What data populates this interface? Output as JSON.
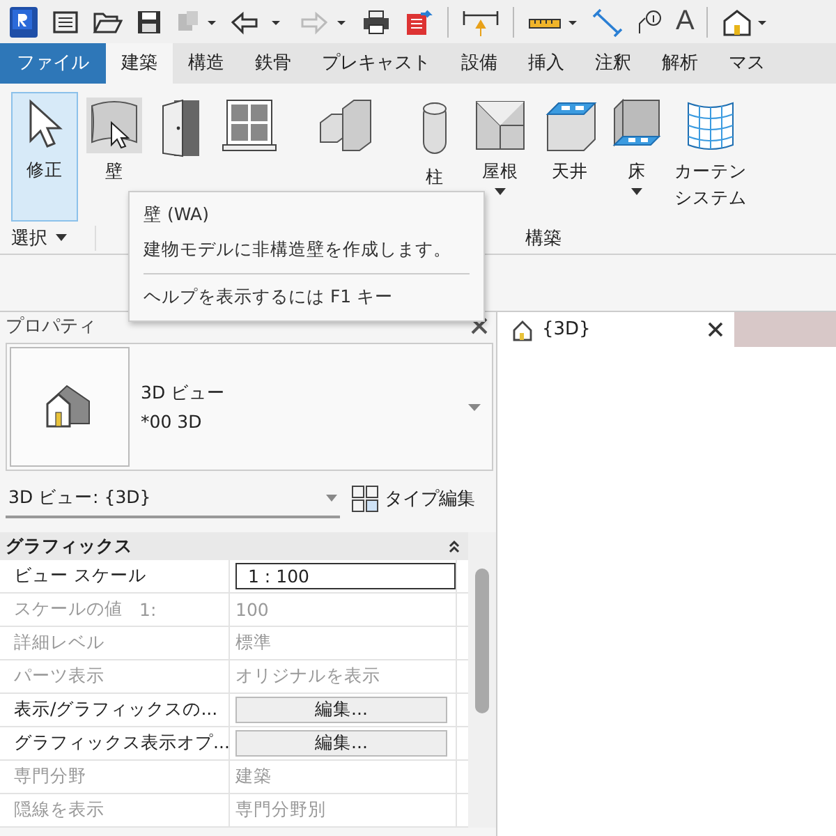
{
  "quick_access": {
    "text_tool": "A"
  },
  "tabs": [
    {
      "label": "ファイル",
      "kind": "file",
      "selected": false
    },
    {
      "label": "建築",
      "kind": "tab",
      "selected": true
    },
    {
      "label": "構造",
      "kind": "tab",
      "selected": false
    },
    {
      "label": "鉄骨",
      "kind": "tab",
      "selected": false
    },
    {
      "label": "プレキャスト",
      "kind": "tab",
      "selected": false
    },
    {
      "label": "設備",
      "kind": "tab",
      "selected": false
    },
    {
      "label": "挿入",
      "kind": "tab",
      "selected": false
    },
    {
      "label": "注釈",
      "kind": "tab",
      "selected": false
    },
    {
      "label": "解析",
      "kind": "tab",
      "selected": false
    },
    {
      "label": "マス",
      "kind": "tab",
      "selected": false
    }
  ],
  "ribbon_tools": [
    {
      "kind": "cursor",
      "label": "修正",
      "selected": true,
      "hovered": false
    },
    {
      "kind": "wall",
      "label": "壁",
      "selected": false,
      "hovered": true
    },
    {
      "kind": "door",
      "selected": false,
      "hovered": false
    },
    {
      "kind": "window",
      "selected": false,
      "hovered": false
    },
    {
      "kind": "component",
      "selected": false,
      "hovered": false
    },
    {
      "kind": "column",
      "label": "柱",
      "selected": false,
      "hovered": false
    },
    {
      "kind": "roof",
      "label": "屋根",
      "dropdown": true,
      "selected": false,
      "hovered": false
    },
    {
      "kind": "ceiling",
      "label": "天井",
      "selected": false,
      "hovered": false
    },
    {
      "kind": "floor",
      "label": "床",
      "dropdown": true,
      "selected": false,
      "hovered": false
    },
    {
      "kind": "curtain",
      "label": "カーテンシステム",
      "selected": false,
      "hovered": false
    }
  ],
  "ribbon_panels": [
    {
      "label": "選択",
      "dropdown": true
    },
    {
      "label": "構築",
      "dropdown": false
    }
  ],
  "tooltip": {
    "title": "壁 (WA)",
    "description": "建物モデルに非構造壁を作成します。",
    "help": "ヘルプを表示するには F1 キー"
  },
  "properties": {
    "title": "プロパティ",
    "type_name": "3D ビュー",
    "type_sub": "*00 3D",
    "selector": "3D ビュー: {3D}",
    "edit_type": "タイプ編集",
    "section": "グラフィックス",
    "rows": [
      {
        "label": "ビュー スケール",
        "value": "1 : 100",
        "kind": "field",
        "disabled": false
      },
      {
        "label": "スケールの値",
        "suffix": "1:",
        "value": "100",
        "kind": "text",
        "disabled": true
      },
      {
        "label": "詳細レベル",
        "value": "標準",
        "kind": "text",
        "disabled": true
      },
      {
        "label": "パーツ表示",
        "value": "オリジナルを表示",
        "kind": "text",
        "disabled": true
      },
      {
        "label": "表示/グラフィックスの...",
        "value": "編集...",
        "kind": "button",
        "disabled": false
      },
      {
        "label": "グラフィックス表示オプ...",
        "value": "編集...",
        "kind": "button",
        "disabled": false
      },
      {
        "label": "専門分野",
        "value": "建築",
        "kind": "text",
        "disabled": true
      },
      {
        "label": "隠線を表示",
        "value": "専門分野別",
        "kind": "text",
        "disabled": true
      }
    ]
  },
  "view_tab": {
    "title": "{3D}"
  }
}
